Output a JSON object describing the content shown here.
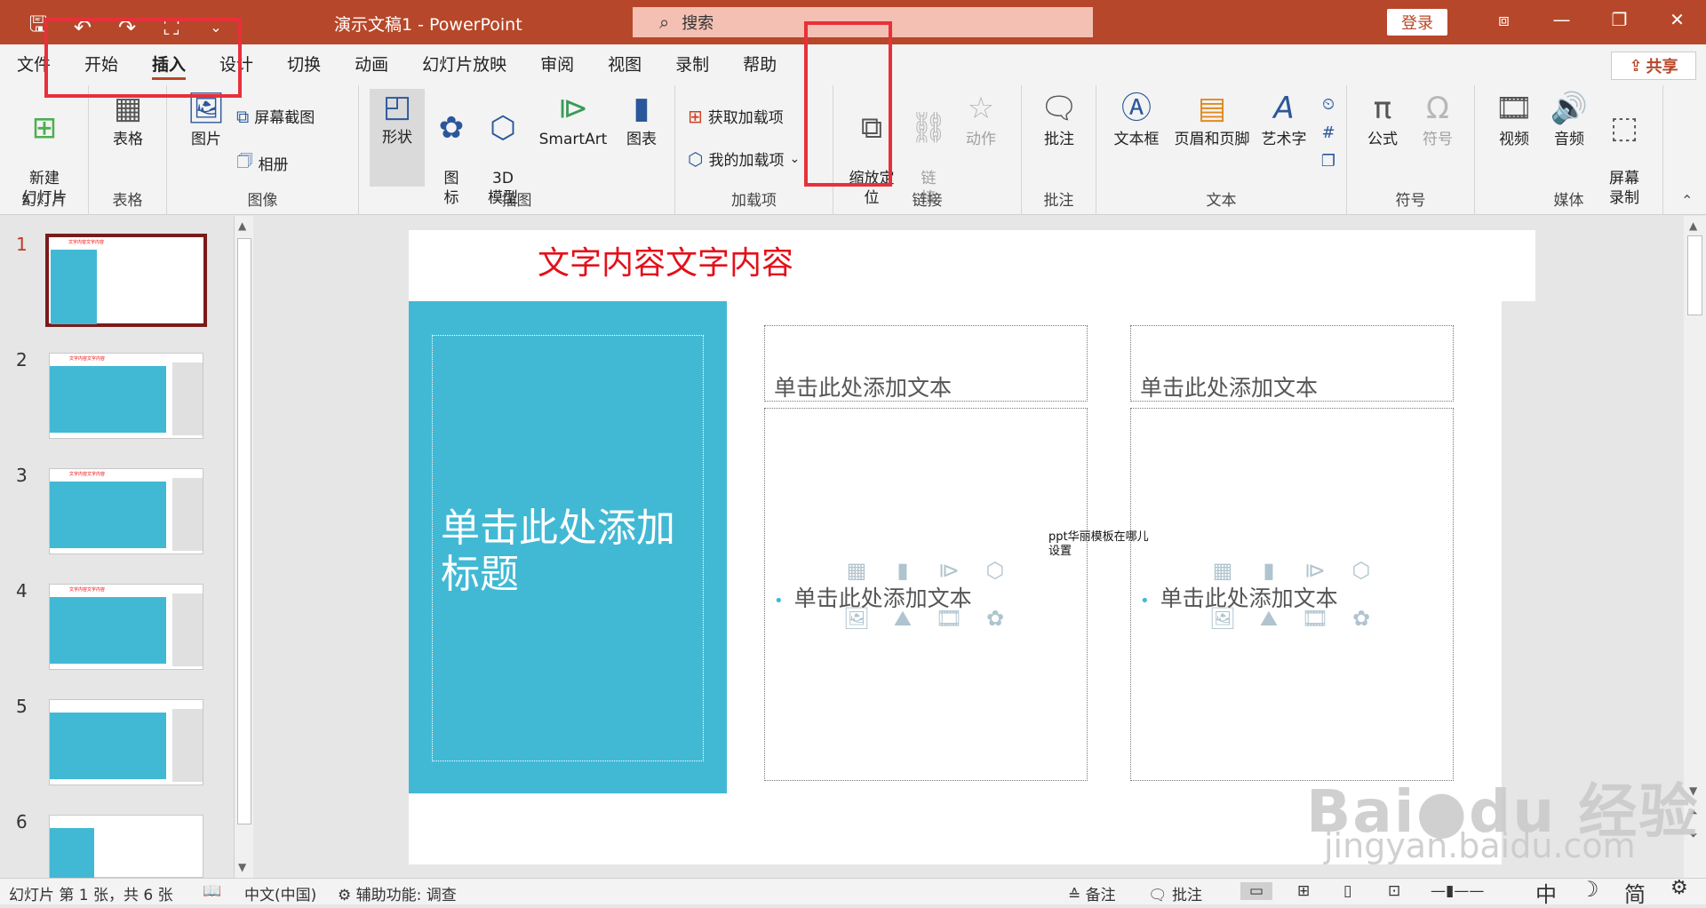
{
  "titlebar": {
    "doc_title": "演示文稿1  -  PowerPoint",
    "search_placeholder": "搜索",
    "login_label": "登录",
    "qat": [
      "save-icon",
      "undo-icon",
      "redo-icon",
      "present-icon",
      "customize-icon"
    ]
  },
  "tabs": [
    "文件",
    "开始",
    "插入",
    "设计",
    "切换",
    "动画",
    "幻灯片放映",
    "审阅",
    "视图",
    "录制",
    "帮助"
  ],
  "active_tab": "插入",
  "share_label": "共享",
  "ribbon": {
    "slides": {
      "label": "幻灯片",
      "new_slide": "新建\n幻灯片"
    },
    "tables": {
      "label": "表格",
      "table": "表格"
    },
    "images": {
      "label": "图像",
      "pictures": "图片",
      "screenshot": "屏幕截图",
      "album": "相册"
    },
    "illustrations": {
      "label": "插图",
      "shapes": "形状",
      "icons": "图\n标",
      "model3d": "3D\n模型",
      "smartart": "SmartArt",
      "chart": "图表"
    },
    "addins": {
      "label": "加载项",
      "get": "获取加载项",
      "my": "我的加载项"
    },
    "links": {
      "label": "链接",
      "zoom": "缩放定\n位",
      "link": "链\n接",
      "action": "动作"
    },
    "comments": {
      "label": "批注",
      "comment": "批注"
    },
    "text": {
      "label": "文本",
      "textbox": "文本框",
      "header_footer": "页眉和页脚",
      "wordart": "艺术字"
    },
    "symbols": {
      "label": "符号",
      "equation": "公式",
      "symbol": "符号"
    },
    "media": {
      "label": "媒体",
      "video": "视频",
      "audio": "音频",
      "screen_rec": "屏幕\n录制"
    }
  },
  "thumbnails": [
    {
      "num": "1",
      "title": "文字内容文字内容"
    },
    {
      "num": "2",
      "title": "文字内容文字内容"
    },
    {
      "num": "3",
      "title": "文字内容文字内容"
    },
    {
      "num": "4",
      "title": "文字内容文字内容"
    },
    {
      "num": "5",
      "title": ""
    },
    {
      "num": "6",
      "title": ""
    }
  ],
  "slide": {
    "title": "文字内容文字内容",
    "blue_title": "单击此处添加标题",
    "left_heading": "单击此处添加文本",
    "right_heading": "单击此处添加文本",
    "left_body": "单击此处添加文本",
    "right_body": "单击此处添加文本",
    "note": "ppt华丽模板在哪儿\n设置"
  },
  "statusbar": {
    "slide_info": "幻灯片 第 1 张，共 6 张",
    "language": "中文(中国)",
    "accessibility": "辅助功能: 调查",
    "notes": "备注",
    "comments": "批注",
    "ime1": "中",
    "ime3": "简"
  },
  "watermark": {
    "main": "Bai●du 经验",
    "sub": "jingyan.baidu.com"
  }
}
